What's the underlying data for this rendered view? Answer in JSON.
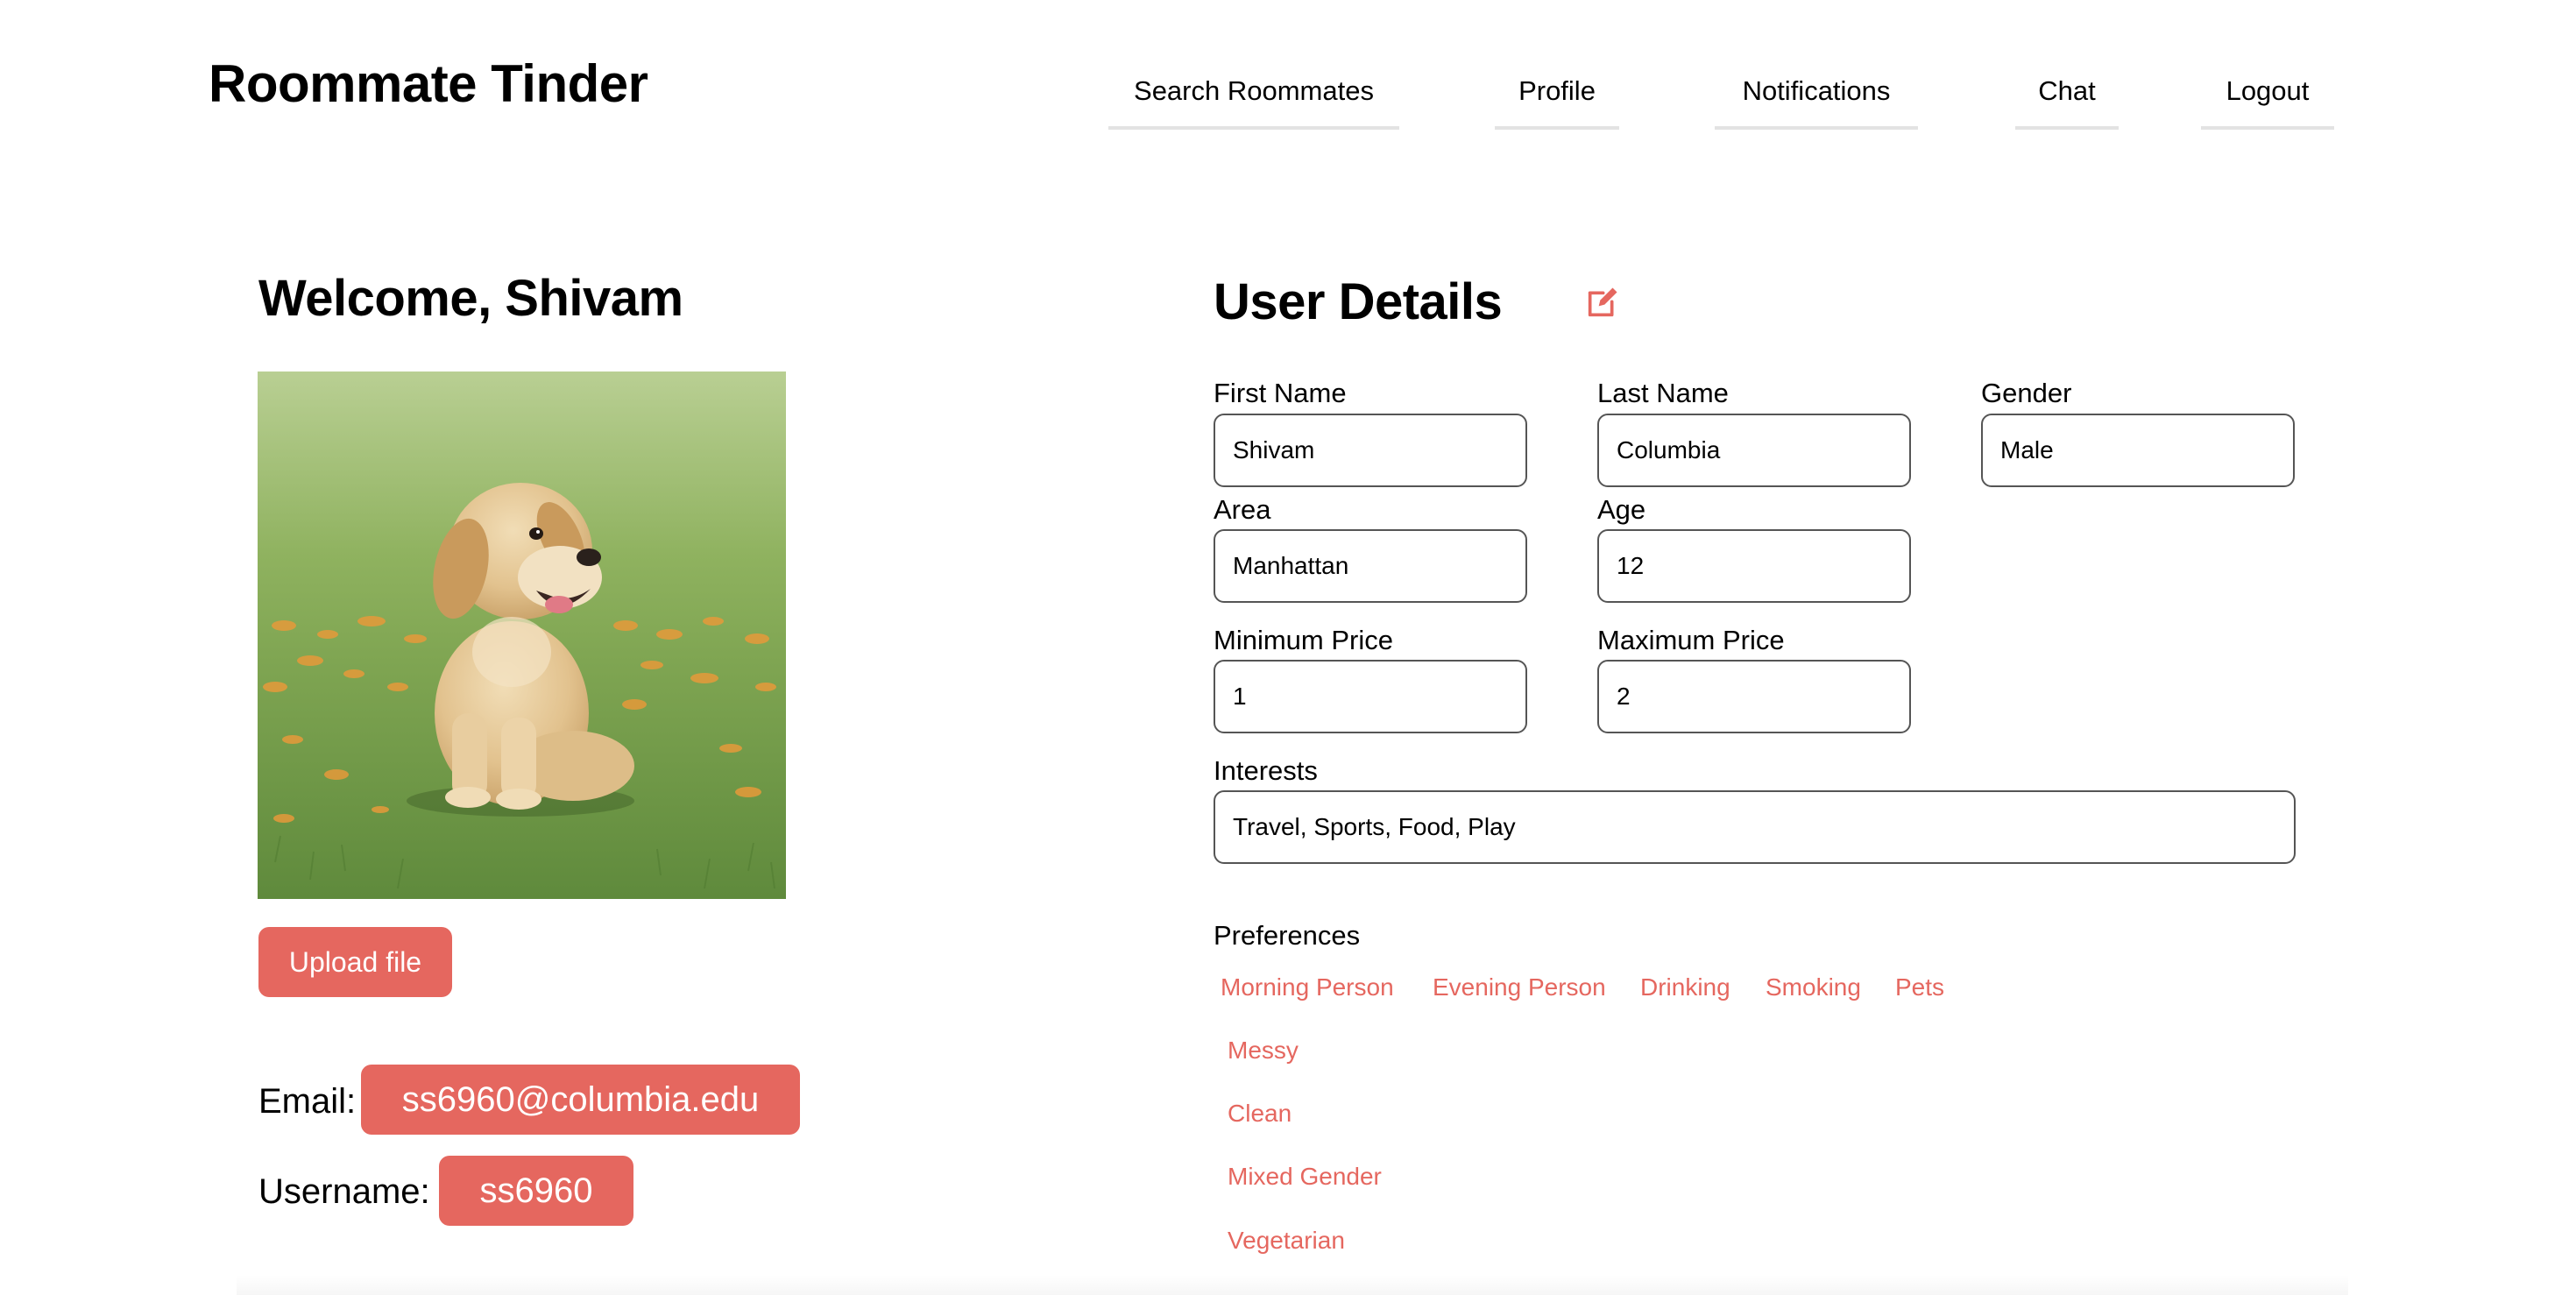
{
  "app": {
    "title": "Roommate Tinder"
  },
  "nav": {
    "items": [
      {
        "label": "Search Roommates"
      },
      {
        "label": "Profile"
      },
      {
        "label": "Notifications"
      },
      {
        "label": "Chat"
      },
      {
        "label": "Logout"
      }
    ]
  },
  "profile": {
    "welcome": "Welcome, Shivam",
    "photo_description": "puppy-photo",
    "upload_label": "Upload file",
    "email_label": "Email:",
    "email": "ss6960@columbia.edu",
    "username_label": "Username:",
    "username": "ss6960"
  },
  "details": {
    "title": "User Details",
    "edit_icon": "edit-icon",
    "fields": {
      "first_name": {
        "label": "First Name",
        "value": "Shivam"
      },
      "last_name": {
        "label": "Last Name",
        "value": "Columbia"
      },
      "gender": {
        "label": "Gender",
        "value": "Male"
      },
      "area": {
        "label": "Area",
        "value": "Manhattan"
      },
      "age": {
        "label": "Age",
        "value": "12"
      },
      "min_price": {
        "label": "Minimum Price",
        "value": "1"
      },
      "max_price": {
        "label": "Maximum Price",
        "value": "2"
      },
      "interests": {
        "label": "Interests",
        "value": "Travel, Sports, Food, Play"
      }
    },
    "preferences_label": "Preferences",
    "preferences": [
      "Morning Person",
      "Evening Person",
      "Drinking",
      "Smoking",
      "Pets",
      "Messy",
      "Clean",
      "Mixed Gender",
      "Vegetarian"
    ]
  },
  "colors": {
    "accent": "#e5675f",
    "nav_underline": "#e3e3e3",
    "input_border": "#555555"
  }
}
